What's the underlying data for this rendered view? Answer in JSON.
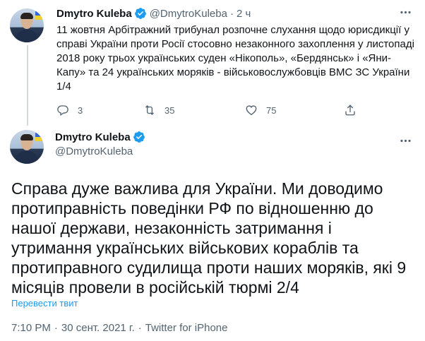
{
  "tweets": [
    {
      "name": "Dmytro Kuleba",
      "handle": "@DmytroKuleba",
      "dot": "·",
      "time": "2 ч",
      "text": "11 жовтня Арбітражний трибунал розпочне слухання щодо юрисдикції у справі України проти Росії стосовно незаконного захоплення у листопаді 2018 року трьох українських суден «Нікополь», «Бердянськ» і «Яни-Капу» та 24 українських моряків - військовослужбовців ВМС ЗС України 1/4",
      "replies": "3",
      "retweets": "35",
      "likes": "75"
    },
    {
      "name": "Dmytro Kuleba",
      "handle": "@DmytroKuleba",
      "text": "Справа дуже важлива для України. Ми доводимо протиправність поведінки РФ по відношенню до нашої держави, незаконність затримання і утримання українських військових кораблів та протиправного судилища проти наших моряків, які 9 місяців провели в російській тюрмі 2/4",
      "translate_label": "Перевести твит",
      "time": "7:10 PM",
      "date": "30 сент. 2021 г.",
      "source": "Twitter for iPhone",
      "sep": "·"
    }
  ],
  "icons": {
    "more": "more-icon",
    "verified": "verified-badge-icon",
    "reply": "reply-icon",
    "retweet": "retweet-icon",
    "like": "like-icon",
    "share": "share-icon"
  },
  "colors": {
    "text": "#0f1419",
    "secondary": "#536471",
    "link": "#1d9bf0",
    "verified": "#1d9bf0",
    "thread_line": "#cfd9de"
  }
}
